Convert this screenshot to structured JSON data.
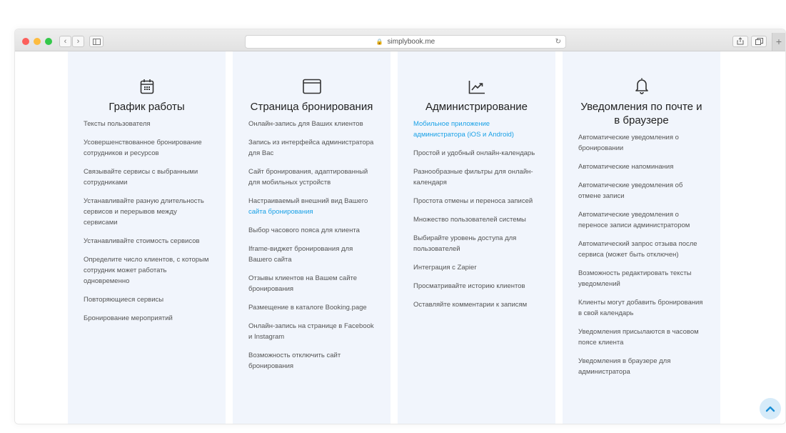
{
  "browser": {
    "url": "simplybook.me",
    "back_glyph": "‹",
    "forward_glyph": "›",
    "reload_glyph": "↻",
    "plus_glyph": "+"
  },
  "colors": {
    "column_bg": "#f1f5fc",
    "link": "#1aa1e6",
    "text": "#555555",
    "title": "#222222"
  },
  "columns": [
    {
      "icon": "calendar-icon",
      "title": "График работы",
      "items": [
        {
          "text": "Тексты пользователя"
        },
        {
          "text": "Усовершенствованное бронирование сотрудников и ресурсов"
        },
        {
          "text": "Связывайте сервисы с выбранными сотрудниками"
        },
        {
          "text": "Устанавливайте разную длительность сервисов и перерывов между сервисами"
        },
        {
          "text": "Устанавливайте стоимость сервисов"
        },
        {
          "text": "Определите число клиентов, с которым сотрудник может работать одновременно"
        },
        {
          "text": "Повторяющиеся сервисы"
        },
        {
          "text": "Бронирование мероприятий"
        }
      ]
    },
    {
      "icon": "browser-window-icon",
      "title": "Страница бронирования",
      "items": [
        {
          "text": "Онлайн-запись для Ваших клиентов"
        },
        {
          "text": "Запись из интерфейса администратора для Вас"
        },
        {
          "text": "Сайт бронирования, адаптированный для мобильных устройств"
        },
        {
          "text": "Настраиваемый внешний вид Вашего ",
          "link": "сайта бронирования"
        },
        {
          "text": "Выбор часового пояса для клиента"
        },
        {
          "text": "Iframe-виджет бронирования для Вашего сайта"
        },
        {
          "text": "Отзывы клиентов на Вашем сайте бронирования"
        },
        {
          "text": "Размещение в каталоге Booking.page"
        },
        {
          "text": "Онлайн-запись на странице в Facebook и Instagram"
        },
        {
          "text": "Возможность отключить сайт бронирования"
        }
      ]
    },
    {
      "icon": "chart-trend-icon",
      "title": "Администрирование",
      "items": [
        {
          "text": "Мобильное приложение администратора (iOS и Android)",
          "is_link": true
        },
        {
          "text": "Простой и удобный онлайн-календарь"
        },
        {
          "text": "Разнообразные фильтры для онлайн-календаря"
        },
        {
          "text": "Простота отмены и переноса записей"
        },
        {
          "text": "Множество пользователей системы"
        },
        {
          "text": "Выбирайте уровень доступа для пользователей"
        },
        {
          "text": "Интеграция с Zapier"
        },
        {
          "text": "Просматривайте историю клиентов"
        },
        {
          "text": "Оставляйте комментарии к записям"
        }
      ]
    },
    {
      "icon": "bell-icon",
      "title": "Уведомления по почте и в браузере",
      "items": [
        {
          "text": "Автоматические уведомления о бронировании"
        },
        {
          "text": "Автоматические напоминания"
        },
        {
          "text": "Автоматические уведомления об отмене записи"
        },
        {
          "text": "Автоматические уведомления о переносе записи администратором"
        },
        {
          "text": "Автоматический запрос отзыва после сервиса (может быть отключен)"
        },
        {
          "text": "Возможность редактировать тексты уведомлений"
        },
        {
          "text": "Клиенты могут добавить бронирования в свой календарь"
        },
        {
          "text": "Уведомления присылаются в часовом поясе клиента"
        },
        {
          "text": "Уведомления в браузере для администратора"
        }
      ]
    }
  ]
}
